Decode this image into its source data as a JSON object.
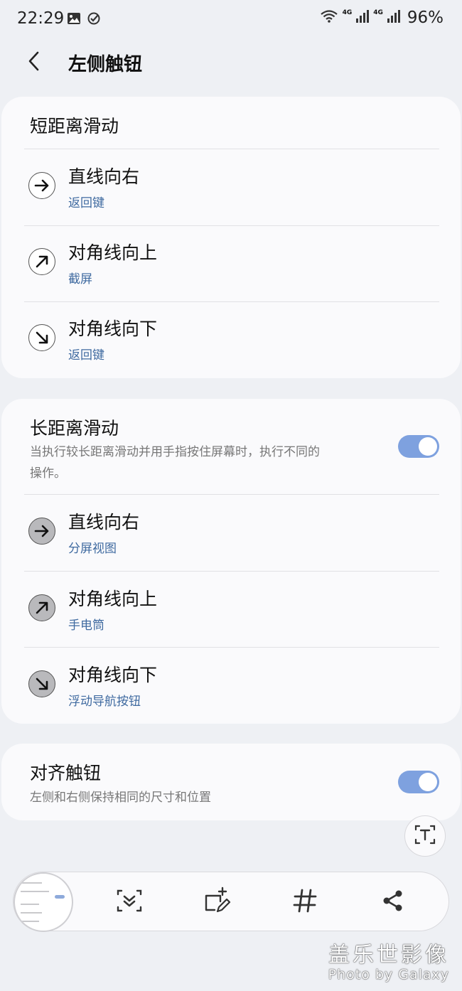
{
  "status_bar": {
    "time": "22:29",
    "battery": "96%",
    "net1": "4G",
    "net2": "4G",
    "icons": [
      "image-icon",
      "check-circle-icon",
      "wifi-icon",
      "signal-icon",
      "signal-icon"
    ]
  },
  "app_bar": {
    "title": "左侧触钮",
    "back_icon": "chevron-left-icon"
  },
  "short_swipe": {
    "header": "短距离滑动",
    "items": [
      {
        "title": "直线向右",
        "action": "返回键",
        "icon": "arrow-right-icon"
      },
      {
        "title": "对角线向上",
        "action": "截屏",
        "icon": "arrow-up-right-icon"
      },
      {
        "title": "对角线向下",
        "action": "返回键",
        "icon": "arrow-down-right-icon"
      }
    ]
  },
  "long_swipe": {
    "header": "长距离滑动",
    "description_line1": "当执行较长距离滑动并用手指按住屏幕时，执行不同的",
    "description_line2": "操作。",
    "enabled": true,
    "items": [
      {
        "title": "直线向右",
        "action": "分屏视图",
        "icon": "arrow-right-icon"
      },
      {
        "title": "对角线向上",
        "action": "手电筒",
        "icon": "arrow-up-right-icon"
      },
      {
        "title": "对角线向下",
        "action": "浮动导航按钮",
        "icon": "arrow-down-right-icon"
      }
    ]
  },
  "align": {
    "header": "对齐触钮",
    "description": "左侧和右侧保持相同的尺寸和位置",
    "enabled": true
  },
  "capture_toolbar": {
    "tools": [
      "scroll-capture-icon",
      "crop-edit-icon",
      "hashtag-icon",
      "share-icon"
    ],
    "text_button_icon": "text-extract-icon"
  },
  "watermark": {
    "title": "盖乐世影像",
    "subtitle": "Photo by Galaxy"
  },
  "colors": {
    "background": "#eef0f4",
    "card": "#fafafc",
    "link": "#3f6aa0",
    "toggle_on": "#7ea1df"
  }
}
